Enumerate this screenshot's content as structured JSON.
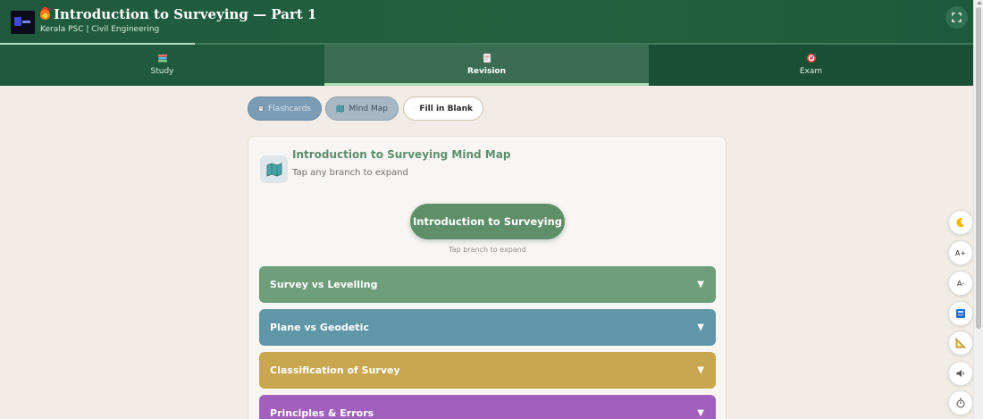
{
  "header": {
    "title": "Introduction to Surveying — Part 1",
    "subtitle": "Kerala PSC | Civil Engineering",
    "progress_fraction": 0.2
  },
  "tabs": [
    {
      "label": "Study",
      "icon": "books-icon"
    },
    {
      "label": "Revision",
      "icon": "memo-icon",
      "active": true
    },
    {
      "label": "Exam",
      "icon": "target-icon"
    }
  ],
  "modes": {
    "flashcards": "Flashcards",
    "mind_map": "Mind Map",
    "fill_blank": "Fill in Blank"
  },
  "mindmap": {
    "title": "Introduction to Surveying Mind Map",
    "subtitle": "Tap any branch to expand",
    "root": "Introduction to Surveying",
    "root_hint": "Tap branch to expand",
    "branches": [
      {
        "label": "Survey vs Levelling",
        "color": "#6f9e7b"
      },
      {
        "label": "Plane vs Geodetic",
        "color": "#5f97a8"
      },
      {
        "label": "Classification of Survey",
        "color": "#c9a74f"
      },
      {
        "label": "Principles & Errors",
        "color": "#a25fbd"
      }
    ],
    "expand_glyph": "▼"
  },
  "side_tools": {
    "font_increase": "A+",
    "font_decrease": "A-"
  }
}
